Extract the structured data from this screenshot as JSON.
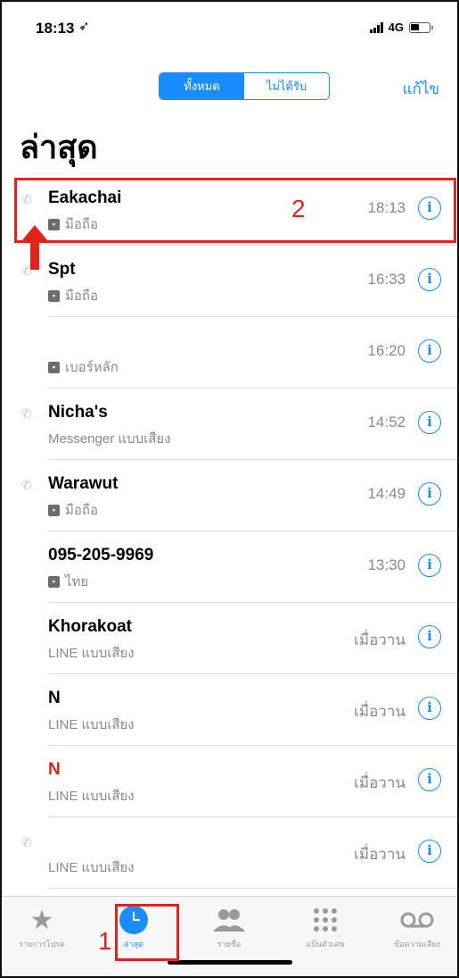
{
  "status": {
    "time": "18:13",
    "location_glyph": "➶",
    "network": "4G"
  },
  "filter": {
    "all": "ทั้งหมด",
    "missed": "ไม่ได้รับ",
    "edit": "แก้ไข"
  },
  "title": "ล่าสุด",
  "calls": [
    {
      "name": "Eakachai",
      "sub": "มือถือ",
      "sim": true,
      "time": "18:13",
      "outgoing": true,
      "missed": false
    },
    {
      "name": "Spt",
      "sub": "มือถือ",
      "sim": true,
      "time": "16:33",
      "outgoing": true,
      "missed": false
    },
    {
      "name": "",
      "sub": "เบอร์หลัก",
      "sim": true,
      "time": "16:20",
      "outgoing": false,
      "missed": false
    },
    {
      "name": "Nicha's",
      "sub": "Messenger แบบเสียง",
      "sim": false,
      "time": "14:52",
      "outgoing": true,
      "missed": false
    },
    {
      "name": "Warawut",
      "sub": "มือถือ",
      "sim": true,
      "time": "14:49",
      "outgoing": true,
      "missed": false
    },
    {
      "name": "095-205-9969",
      "sub": "ไทย",
      "sim": true,
      "time": "13:30",
      "outgoing": false,
      "missed": false
    },
    {
      "name": "Khorakoat",
      "sub": "LINE แบบเสียง",
      "sim": false,
      "time": "เมื่อวาน",
      "outgoing": false,
      "missed": false
    },
    {
      "name": "N",
      "sub": "LINE แบบเสียง",
      "sim": false,
      "time": "เมื่อวาน",
      "outgoing": false,
      "missed": false
    },
    {
      "name": "N",
      "sub": "LINE แบบเสียง",
      "sim": false,
      "time": "เมื่อวาน",
      "outgoing": false,
      "missed": true
    },
    {
      "name": "",
      "sub": "LINE แบบเสียง",
      "sim": false,
      "time": "เมื่อวาน",
      "outgoing": true,
      "missed": false
    }
  ],
  "tabs": [
    {
      "label": "รายการโปรด",
      "icon": "star-icon"
    },
    {
      "label": "ล่าสุด",
      "icon": "clock-icon",
      "active": true
    },
    {
      "label": "รายชื่อ",
      "icon": "contacts-icon"
    },
    {
      "label": "แป้นตัวเลข",
      "icon": "keypad-icon"
    },
    {
      "label": "ข้อความเสียง",
      "icon": "voicemail-icon"
    }
  ],
  "annotations": {
    "one": "1",
    "two": "2"
  },
  "colors": {
    "accent": "#1a8cff",
    "annotation": "#e0231b"
  }
}
